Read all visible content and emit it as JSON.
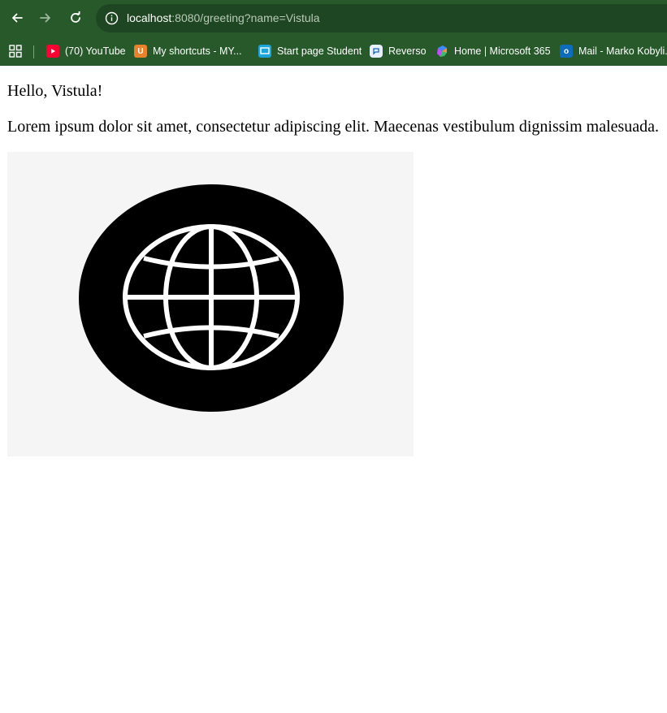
{
  "browser": {
    "url_host": "localhost",
    "url_rest": ":8080/greeting?name=Vistula",
    "bookmarks": [
      {
        "label": "(70) YouTube",
        "icon": "youtube-icon",
        "color": "#ff0033"
      },
      {
        "label": "My shortcuts - MY...",
        "icon": "shortcut-u-icon",
        "color": "#e8822b"
      },
      {
        "label": "Start page Student",
        "icon": "student-icon",
        "color": "#1aa6d9"
      },
      {
        "label": "Reverso",
        "icon": "reverso-icon",
        "color": "#e8f0ff"
      },
      {
        "label": "Home | Microsoft 365",
        "icon": "microsoft365-icon",
        "color": "#7a5cff"
      },
      {
        "label": "Mail - Marko Kobyli...",
        "icon": "outlook-icon",
        "color": "#0f6cbd"
      }
    ]
  },
  "page": {
    "greeting": "Hello, Vistula!",
    "paragraph": "Lorem ipsum dolor sit amet, consectetur adipiscing elit. Maecenas vestibulum dignissim malesuada.",
    "image_icon": "globe-icon"
  }
}
